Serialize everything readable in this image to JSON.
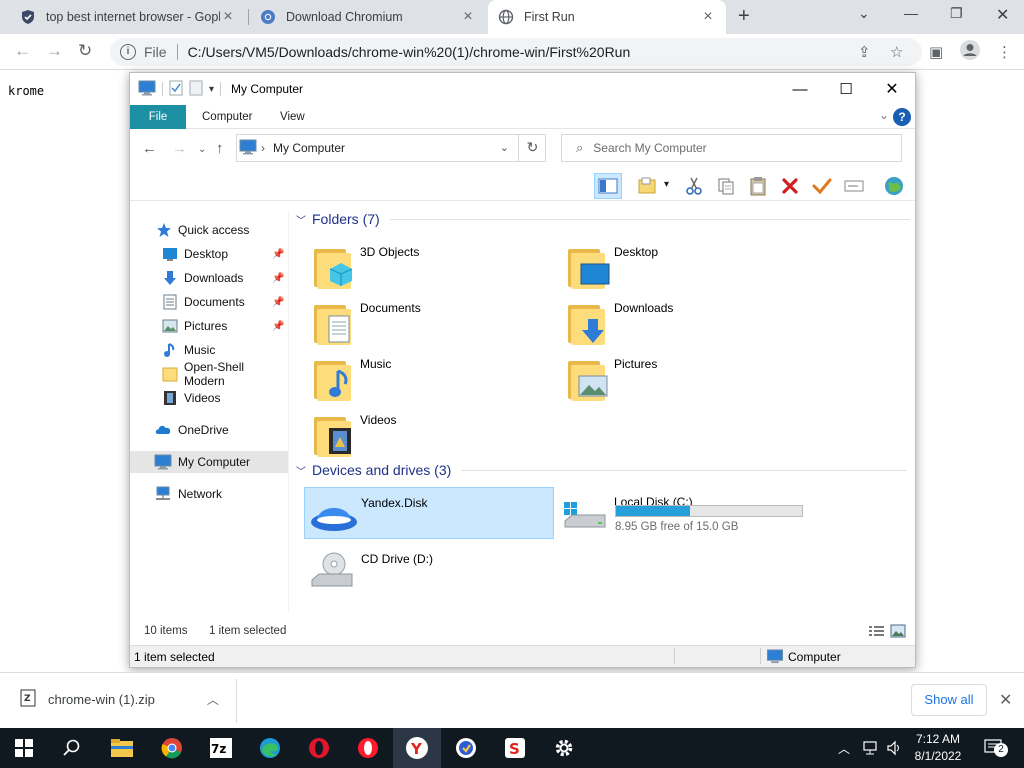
{
  "browser": {
    "tabs": [
      {
        "title": "top best internet browser - Goph",
        "icon": "shield-icon",
        "active": false
      },
      {
        "title": "Download Chromium",
        "icon": "chromium-icon",
        "active": false
      },
      {
        "title": "First Run",
        "icon": "globe-icon",
        "active": true
      }
    ],
    "scheme_label": "File",
    "url": "C:/Users/VM5/Downloads/chrome-win%20(1)/chrome-win/First%20Run"
  },
  "page": {
    "text": "krome"
  },
  "explorer": {
    "title": "My Computer",
    "ribbon_tabs": [
      "File",
      "Computer",
      "View"
    ],
    "address": "My Computer",
    "search_placeholder": "Search My Computer",
    "nav": {
      "quick_access": "Quick access",
      "quick_items": [
        {
          "label": "Desktop",
          "pinned": true
        },
        {
          "label": "Downloads",
          "pinned": true
        },
        {
          "label": "Documents",
          "pinned": true
        },
        {
          "label": "Pictures",
          "pinned": true
        },
        {
          "label": "Music",
          "pinned": false
        },
        {
          "label": "Open-Shell Modern",
          "pinned": false
        },
        {
          "label": "Videos",
          "pinned": false
        }
      ],
      "onedrive": "OneDrive",
      "my_computer": "My Computer",
      "network": "Network"
    },
    "folders_header": "Folders (7)",
    "folders": [
      "3D Objects",
      "Desktop",
      "Documents",
      "Downloads",
      "Music",
      "Pictures",
      "Videos"
    ],
    "devices_header": "Devices and drives (3)",
    "drives": [
      {
        "label": "Yandex.Disk",
        "selected": true
      },
      {
        "label": "Local Disk (C:)",
        "free_text": "8.95 GB free of 15.0 GB",
        "used_fraction": 0.4
      },
      {
        "label": "CD Drive (D:)"
      }
    ],
    "status": {
      "items": "10 items",
      "selected": "1 item selected",
      "bottom_left": "1 item selected",
      "bottom_right": "Computer"
    }
  },
  "download_shelf": {
    "file": "chrome-win (1).zip",
    "show_all": "Show all"
  },
  "taskbar": {
    "time": "7:12 AM",
    "date": "8/1/2022",
    "notification_count": "2"
  }
}
